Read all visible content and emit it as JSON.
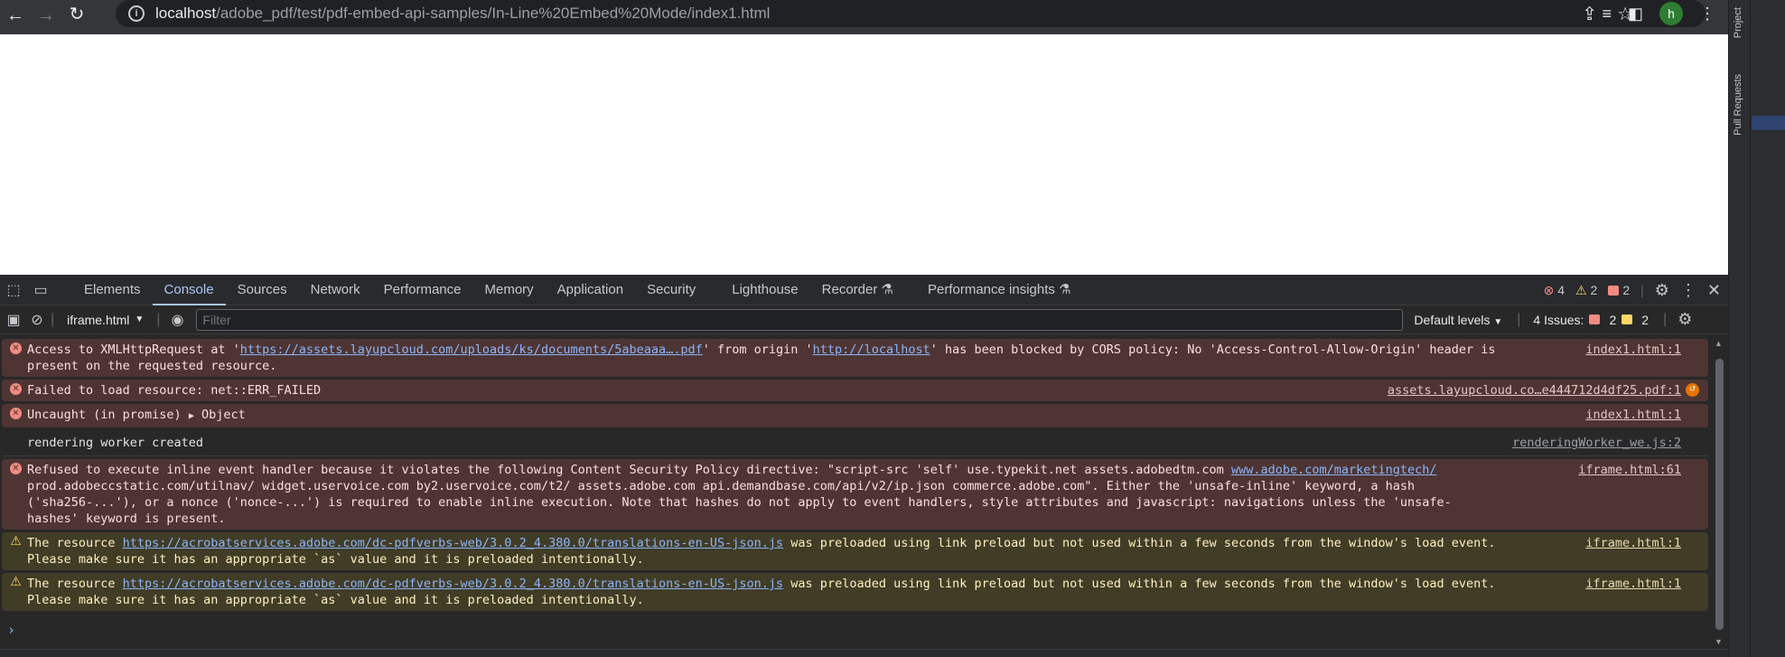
{
  "browser": {
    "url_host": "localhost",
    "url_path": "/adobe_pdf/test/pdf-embed-api-samples/In-Line%20Embed%20Mode/index1.html",
    "avatar_letter": "h"
  },
  "ide": {
    "project_label": "Project",
    "pull_requests_label": "Pull Requests"
  },
  "devtools": {
    "tabs": [
      "Elements",
      "Console",
      "Sources",
      "Network",
      "Performance",
      "Memory",
      "Application",
      "Security",
      "Lighthouse",
      "Recorder",
      "Performance insights"
    ],
    "active_tab": "Console",
    "error_count": "4",
    "warning_count": "2",
    "issue_badge_count": "2",
    "context": "iframe.html",
    "filter_placeholder": "Filter",
    "levels": "Default levels",
    "issues_label": "4 Issues:",
    "issues_errors": "2",
    "issues_warnings": "2"
  },
  "console": {
    "messages": [
      {
        "level": "error",
        "text_before": "Access to XMLHttpRequest at '",
        "link1": "https://assets.layupcloud.com/uploads/ks/documents/5abeaaa….pdf",
        "text_mid": "' from origin '",
        "link2": "http://localhost",
        "text_after": "' has been blocked by CORS policy: No 'Access-Control-Allow-Origin' header is present on the requested resource.",
        "source": "index1.html:1"
      },
      {
        "level": "error",
        "text": "Failed to load resource: net::ERR_FAILED",
        "source": "assets.layupcloud.co…e444712d4df25.pdf:1"
      },
      {
        "level": "error",
        "text_prefix": "Uncaught (in promise) ",
        "object_label": "Object",
        "source": "index1.html:1"
      },
      {
        "level": "info",
        "text": "rendering worker created",
        "source": "renderingWorker_we.js:2"
      },
      {
        "level": "error",
        "text_before": "Refused to execute inline event handler because it violates the following Content Security Policy directive: \"script-src 'self' use.typekit.net assets.adobedtm.com ",
        "link1": "www.adobe.com/marketingtech/",
        "text_after": " prod.adobeccstatic.com/utilnav/ widget.uservoice.com by2.uservoice.com/t2/ assets.adobe.com api.demandbase.com/api/v2/ip.json commerce.adobe.com\". Either the 'unsafe-inline' keyword, a hash ('sha256-...'), or a nonce ('nonce-...') is required to enable inline execution. Note that hashes do not apply to event handlers, style attributes and javascript: navigations unless the 'unsafe-hashes' keyword is present.",
        "source": "iframe.html:61"
      },
      {
        "level": "warn",
        "text_before": "The resource ",
        "link1": "https://acrobatservices.adobe.com/dc-pdfverbs-web/3.0.2_4.380.0/translations-en-US-json.js",
        "text_after": " was preloaded using link preload but not used within a few seconds from the window's load event. Please make sure it has an appropriate `as` value and it is preloaded intentionally.",
        "source": "iframe.html:1"
      },
      {
        "level": "warn",
        "text_before": "The resource ",
        "link1": "https://acrobatservices.adobe.com/dc-pdfverbs-web/3.0.2_4.380.0/translations-en-US-json.js",
        "text_after": " was preloaded using link preload but not used within a few seconds from the window's load event. Please make sure it has an appropriate `as` value and it is preloaded intentionally.",
        "source": "iframe.html:1"
      }
    ],
    "prompt_glyph": "›"
  },
  "colors": {
    "error_bg": "#4e3534",
    "warn_bg": "#413c26",
    "accent": "#a8c7fa"
  }
}
